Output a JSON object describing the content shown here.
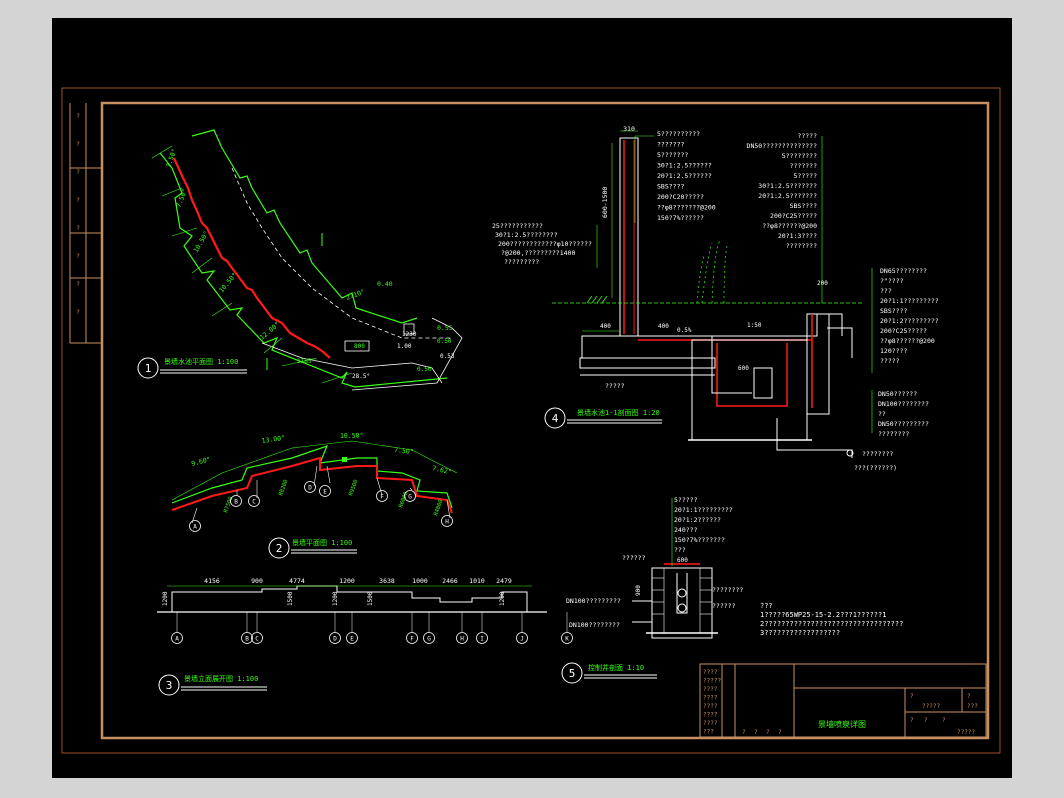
{
  "views": {
    "v1": {
      "num": "1",
      "title": "景墙水池平面图 1:100"
    },
    "v2": {
      "num": "2",
      "title": "景墙平面图 1:100"
    },
    "v3": {
      "num": "3",
      "title": "景墙立面展开图 1:100"
    },
    "v4": {
      "num": "4",
      "title": "景墙水池1-1剖面图 1:20"
    },
    "v5": {
      "num": "5",
      "title": "控制井剖面 1:10"
    }
  },
  "plan1": {
    "angles": [
      "7.50°",
      "7.50°",
      "10.50°",
      "10.50°",
      "12.00°",
      "2710°"
    ],
    "dims": [
      "0.50",
      "0.53",
      "0.50",
      "1.00",
      "1165°",
      "28.5°",
      "800",
      "1230"
    ],
    "levels": [
      "0.40",
      "0.55"
    ]
  },
  "plan2": {
    "angles": [
      "9.60°",
      "13.00°",
      "10.50°",
      "7.50°",
      "7.62°"
    ],
    "labels": [
      "R7500",
      "R8200",
      "R9500",
      "R6000",
      "R4800"
    ]
  },
  "elev3": {
    "dims": [
      "4156",
      "900",
      "4774",
      "1200",
      "3638",
      "1000",
      "2466",
      "1010",
      "2479"
    ],
    "heights": [
      "1200",
      "1500",
      "1200",
      "1500",
      "1200"
    ],
    "axes": [
      "A",
      "B",
      "C",
      "D",
      "E",
      "F",
      "G",
      "H",
      "I",
      "J",
      "K"
    ]
  },
  "sec4": {
    "top_dim": "310",
    "side_dim": "600-1500",
    "dims": [
      "400",
      "400",
      "600",
      "200",
      "0.5%",
      "1:50"
    ],
    "notes_left": [
      "5??????????",
      "???????",
      "5???????",
      "30?1:2.5??????",
      "20?1:2.5??????",
      "SBS????",
      "200?C20?????",
      "??φ8???????@200",
      "150?7%??????"
    ],
    "notes_left2": [
      "25???????????",
      "30?1:2.5????????",
      "200????????????φ10??????",
      "?@200,?????????1400",
      "?????????"
    ],
    "notes_right": [
      "?????",
      "DN50??????????????",
      "5????????",
      "???????",
      "5?????",
      "30?1:2.5???????",
      "20?1:2.5???????",
      "SBS????",
      "200?C25?????",
      "??φ8??????@200",
      "20?1:3????",
      "????????"
    ],
    "notes_right2": [
      "DN65????????",
      "?\"????",
      "???",
      "20?1:1?????????",
      "SBS????",
      "20?1:2?????????",
      "200?C25?????",
      "??φ8??????@200",
      "120????",
      "?????"
    ],
    "notes_right3": [
      "DN50??????",
      "DN100????????",
      "??",
      "DN50?????????",
      "????????"
    ],
    "bottom": [
      "?????",
      "????????",
      "???(??????)"
    ]
  },
  "sec5": {
    "notes": [
      "5?????",
      "20?1:1?????????",
      "20?1:2??????",
      "240???",
      "150?7%???????",
      "???"
    ],
    "pipes": [
      "DN100?????????",
      "DN100????????"
    ],
    "misc": [
      "??????",
      "????????",
      "??????"
    ],
    "dims": [
      "600",
      "900"
    ]
  },
  "general_notes": [
    "???",
    "1?????65WP25-15-2.2???1??????1",
    "2?????????????????????????????????",
    "3??????????????????"
  ],
  "title_block": {
    "drawing_name": "景墙喷泉详图",
    "rows_left": [
      "????",
      "?????",
      "????",
      "????",
      "????",
      "????",
      "????",
      "???"
    ],
    "sign_labels": [
      "?",
      "?",
      "?",
      "?"
    ],
    "right_cells": [
      "?",
      "?",
      "?????",
      "???",
      "?",
      "?",
      "?",
      "?????"
    ]
  },
  "left_strip": [
    "?",
    "?",
    "?",
    "?",
    "?",
    "?",
    "?",
    "?"
  ],
  "colors": {
    "green": "#39ff14",
    "red": "#ff1a1a",
    "white": "#ffffff",
    "border": "#a0522d",
    "frame": "#c89060"
  }
}
